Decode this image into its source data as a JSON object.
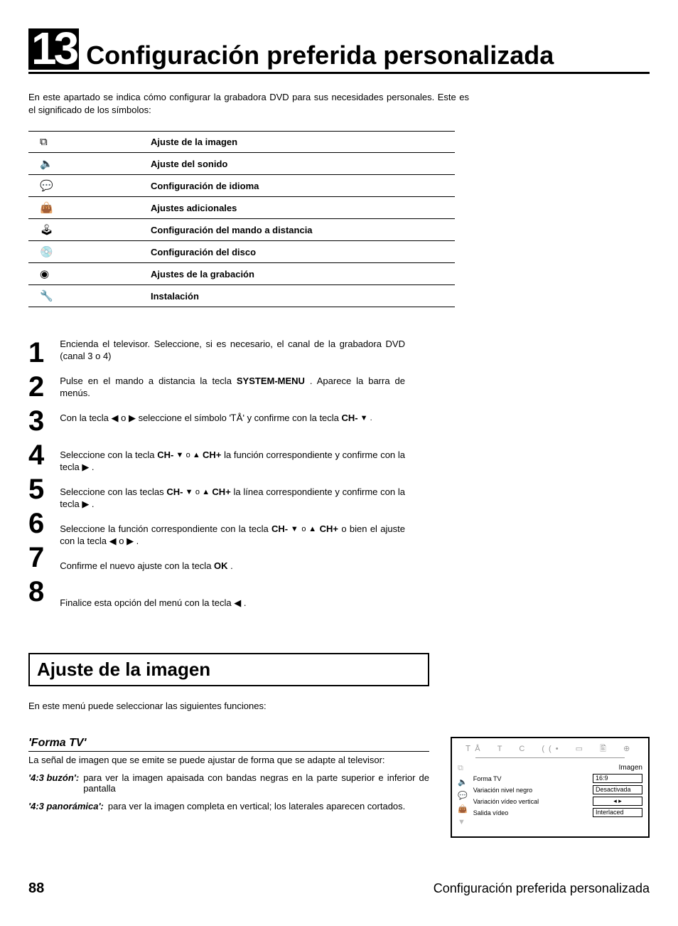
{
  "chapter": {
    "number": "13",
    "title": "Configuración preferida personalizada"
  },
  "intro": "En este apartado se indica cómo configurar la grabadora DVD para sus necesidades personales. Este es el significado de los símbolos:",
  "symbols": [
    {
      "icon": "⧉",
      "label": "Ajuste de la imagen"
    },
    {
      "icon": "🔈",
      "label": "Ajuste del sonido"
    },
    {
      "icon": "💬",
      "label": "Configuración de idioma"
    },
    {
      "icon": "👜",
      "label": "Ajustes adicionales"
    },
    {
      "icon": "🕹",
      "label": "Configuración del mando a distancia"
    },
    {
      "icon": "💿",
      "label": "Configuración del disco"
    },
    {
      "icon": "◉",
      "label": "Ajustes de la grabación"
    },
    {
      "icon": "🔧",
      "label": "Instalación"
    }
  ],
  "steps": {
    "numbers": [
      "1",
      "2",
      "3",
      "4",
      "5",
      "6",
      "7",
      "8"
    ],
    "s1a": "Encienda el televisor. Seleccione, si es necesario, el canal de la grabadora DVD (canal 3 o 4)",
    "s2a": "Pulse en el mando a distancia la tecla ",
    "s2b": "SYSTEM-MENU",
    "s2c": " . Aparece la barra de menús.",
    "s3a": "Con la tecla  ◀ o ▶  seleccione el símbolo 'ᎢÅ' y confirme con la tecla ",
    "s3b": "CH-",
    "s3c": " ▼ .",
    "s4a": "Seleccione con la tecla ",
    "s4b": "CH-",
    "s4c": " ▼ o  ▲ ",
    "s4d": "CH+",
    "s4e": " la función correspondiente y confirme con la tecla ▶ .",
    "s5a": "Seleccione con las teclas ",
    "s5b": "CH-",
    "s5c": " ▼ o  ▲ ",
    "s5d": "CH+",
    "s5e": " la línea correspondiente y confirme con la tecla ▶ .",
    "s6a": "Seleccione la función correspondiente con la tecla ",
    "s6b": "CH-",
    "s6c": " ▼ o ▲ ",
    "s6d": "CH+",
    "s6e": " o bien el ajuste con la tecla ◀ o ▶ .",
    "s7a": "Confirme el nuevo ajuste con la tecla ",
    "s7b": "OK",
    "s7c": " .",
    "s8a": "Finalice esta opción del menú con la tecla ◀ ."
  },
  "section": {
    "title": "Ajuste de la imagen",
    "intro": "En este menú puede seleccionar las siguientes funciones:"
  },
  "formaTV": {
    "head": "'Forma TV'",
    "desc": "La señal de imagen que se emite se puede ajustar de forma que se adapte al televisor:",
    "d1_term": "'4:3 buzón':",
    "d1_desc": "para ver la imagen apaisada con bandas negras en la parte superior e inferior de pantalla",
    "d2_term": "'4:3 panorámica':",
    "d2_desc": "para ver la imagen completa en vertical; los laterales aparecen cortados."
  },
  "osd": {
    "title": "Imagen",
    "rows": [
      {
        "label": "Forma TV",
        "value": "16:9"
      },
      {
        "label": "Variación nivel negro",
        "value": "Desactivada"
      },
      {
        "label": "Variación vídeo vertical",
        "value": "◂    ▸"
      },
      {
        "label": "Salida vídeo",
        "value": "Interlaced"
      }
    ]
  },
  "footer": {
    "page": "88",
    "title": "Configuración preferida personalizada"
  }
}
